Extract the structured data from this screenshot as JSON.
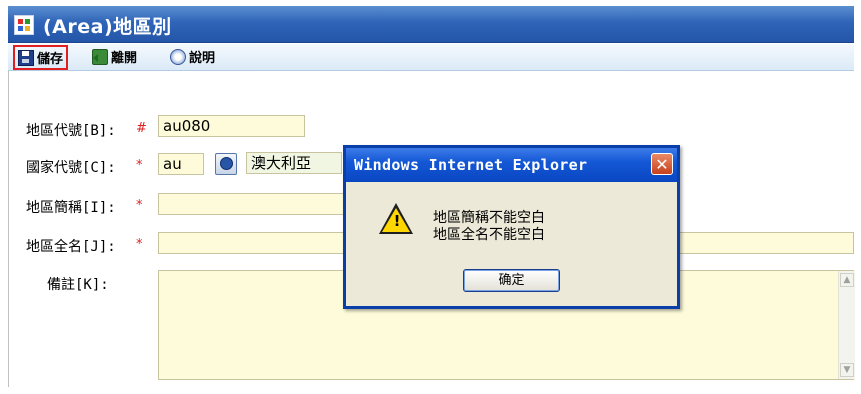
{
  "window": {
    "title": "(Area)地區別",
    "icon": "app-grid-icon"
  },
  "toolbar": {
    "save_label": "儲存",
    "exit_label": "離開",
    "help_label": "說明"
  },
  "form": {
    "area_code": {
      "label": "地區代號[B]:",
      "marker": "#",
      "value": "au080"
    },
    "country_code": {
      "label": "國家代號[C]:",
      "marker": "*",
      "value": "au",
      "country_name": "澳大利亞"
    },
    "area_short": {
      "label": "地區簡稱[I]:",
      "marker": "*",
      "value": ""
    },
    "area_full": {
      "label": "地區全名[J]:",
      "marker": "*",
      "value": ""
    },
    "remark": {
      "label": "備註[K]:",
      "value": ""
    }
  },
  "dialog": {
    "title": "Windows Internet Explorer",
    "close_glyph": "✕",
    "message_line1": "地區簡稱不能空白",
    "message_line2": "地區全名不能空白",
    "ok_label": "确定",
    "icon": "warning-icon"
  },
  "colors": {
    "title_bar": "#2f64b8",
    "field_bg": "#fdfbd9",
    "required_marker": "#e02020",
    "dialog_border": "#0a3ea8"
  }
}
